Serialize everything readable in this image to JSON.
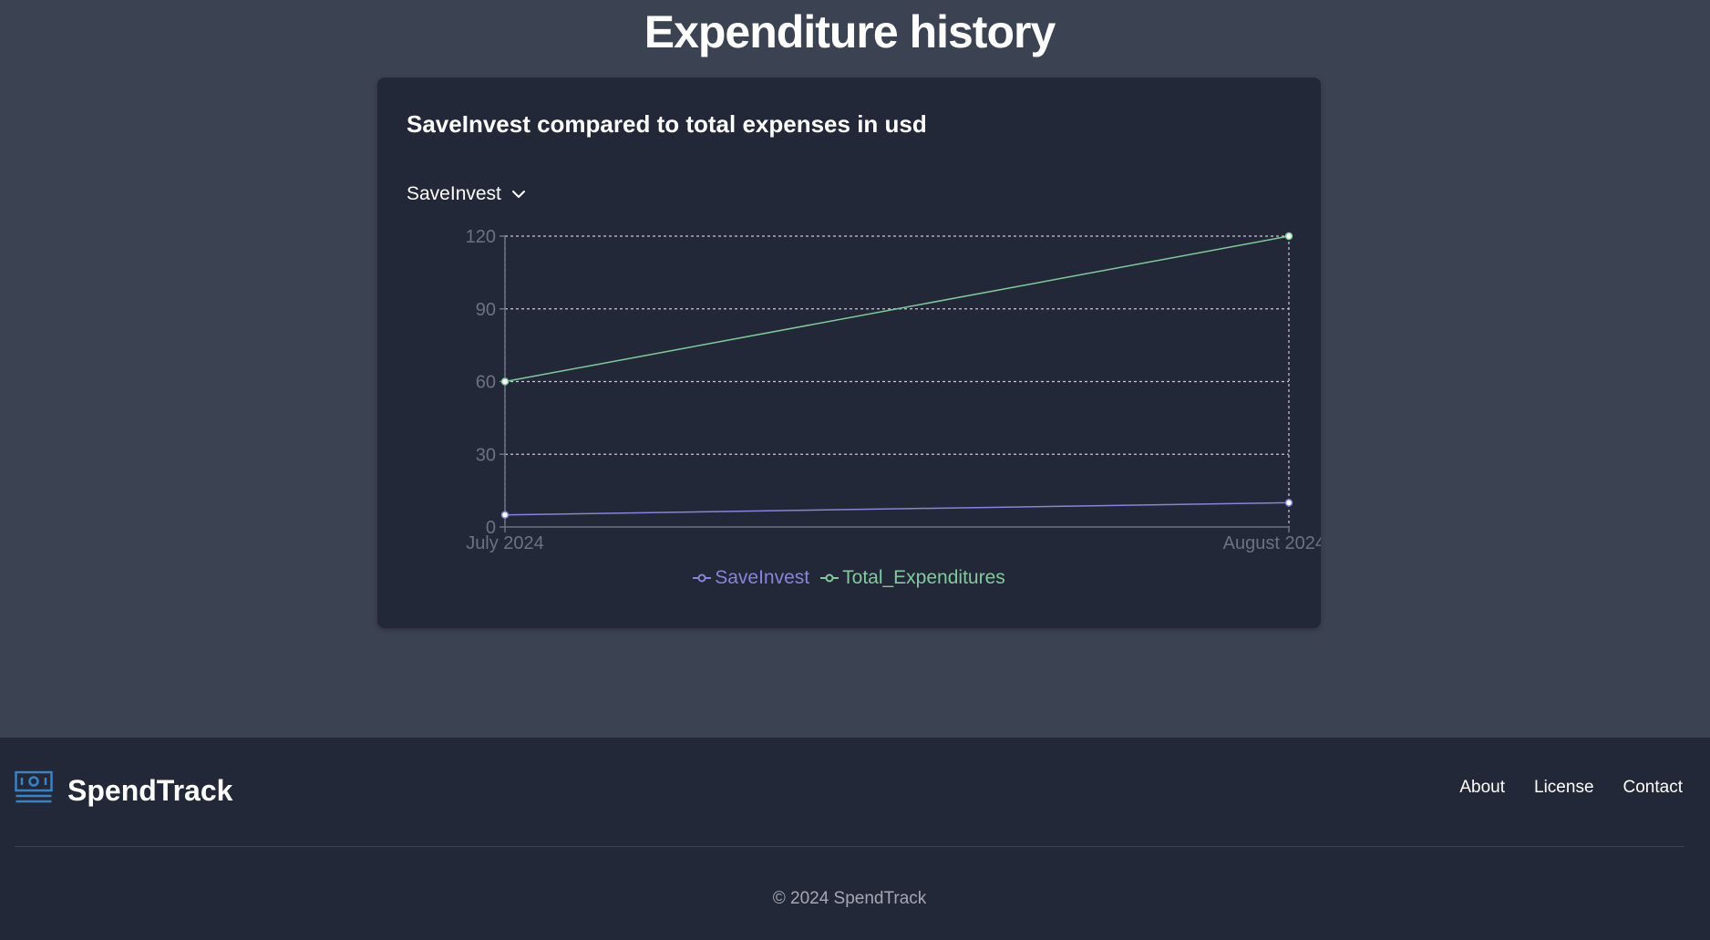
{
  "page": {
    "title": "Expenditure history"
  },
  "card": {
    "title": "SaveInvest compared to total expenses in usd",
    "selector": {
      "selected": "SaveInvest"
    }
  },
  "chart_data": {
    "type": "line",
    "categories": [
      "July 2024",
      "August 2024"
    ],
    "series": [
      {
        "name": "SaveInvest",
        "values": [
          5,
          10
        ],
        "color": "#8884d8"
      },
      {
        "name": "Total_Expenditures",
        "values": [
          60,
          120
        ],
        "color": "#82ca9d"
      }
    ],
    "ylim": [
      0,
      120
    ],
    "yticks": [
      0,
      30,
      60,
      90,
      120
    ],
    "grid": true,
    "legend": "bottom"
  },
  "footer": {
    "brand": "SpendTrack",
    "links": [
      "About",
      "License",
      "Contact"
    ],
    "copyright": "© 2024 SpendTrack"
  },
  "colors": {
    "background": "#3b4252",
    "card": "#222837",
    "axis": "#6b7280",
    "grid": "#e5e7eb",
    "logo": "#3b82c4"
  }
}
